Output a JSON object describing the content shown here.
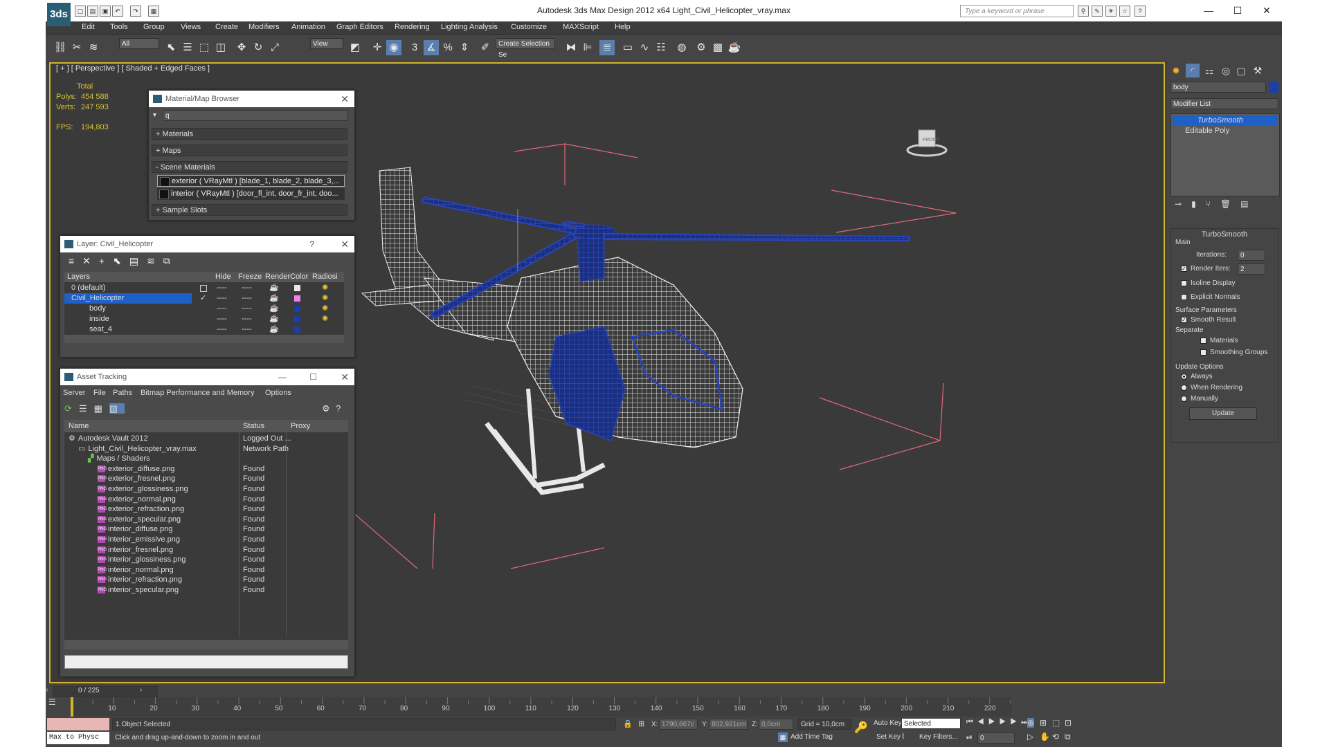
{
  "window": {
    "title": "Autodesk 3ds Max Design 2012 x64      Light_Civil_Helicopter_vray.max",
    "logo": "3ds",
    "search_placeholder": "Type a keyword or phrase"
  },
  "menu": [
    "Edit",
    "Tools",
    "Group",
    "Views",
    "Create",
    "Modifiers",
    "Animation",
    "Graph Editors",
    "Rendering",
    "Lighting Analysis",
    "Customize",
    "MAXScript",
    "Help"
  ],
  "toolbar": {
    "selection_filter": "All",
    "ref_coord": "View",
    "named_selection": "Create Selection Se",
    "snap_label": "3"
  },
  "viewport": {
    "label": "[ + ] [ Perspective ] [ Shaded + Edged Faces ]",
    "stats": {
      "total_label": "Total",
      "polys_label": "Polys:",
      "polys": "454 588",
      "verts_label": "Verts:",
      "verts": "247 593",
      "fps_label": "FPS:",
      "fps": "194,803"
    }
  },
  "material_browser": {
    "title": "Material/Map Browser",
    "search_value": "q",
    "groups": [
      "+ Materials",
      "+ Maps",
      "- Scene Materials",
      "+ Sample Slots"
    ],
    "materials": [
      "exterior ( VRayMtl ) [blade_1, blade_2, blade_3,...",
      "interior ( VRayMtl ) [door_fl_int, door_fr_int, doo..."
    ]
  },
  "layer_manager": {
    "title": "Layer: Civil_Helicopter",
    "help": "?",
    "columns": [
      "Layers",
      "Hide",
      "Freeze",
      "Render",
      "Color",
      "Radiosi"
    ],
    "rows": [
      {
        "name": "0 (default)",
        "color": "#e8e8e8",
        "indent": 0
      },
      {
        "name": "Civil_Helicopter",
        "color": "#f080f0",
        "indent": 0
      },
      {
        "name": "body",
        "color": "#1c3ea8",
        "indent": 1
      },
      {
        "name": "inside",
        "color": "#1c3ea8",
        "indent": 1
      },
      {
        "name": "seat_4",
        "color": "#1c3ea8",
        "indent": 1
      }
    ]
  },
  "asset_tracking": {
    "title": "Asset Tracking",
    "menu": [
      "Server",
      "File",
      "Paths",
      "Bitmap Performance and Memory",
      "Options"
    ],
    "columns": [
      "Name",
      "Status",
      "Proxy"
    ],
    "rows": [
      {
        "name": "Autodesk Vault 2012",
        "status": "Logged Out ...",
        "indent": 0,
        "type": "vault"
      },
      {
        "name": "Light_Civil_Helicopter_vray.max",
        "status": "Network Path",
        "indent": 1,
        "type": "file"
      },
      {
        "name": "Maps / Shaders",
        "status": "",
        "indent": 2,
        "type": "folder"
      },
      {
        "name": "exterior_diffuse.png",
        "status": "Found",
        "indent": 3,
        "type": "png"
      },
      {
        "name": "exterior_fresnel.png",
        "status": "Found",
        "indent": 3,
        "type": "png"
      },
      {
        "name": "exterior_glossiness.png",
        "status": "Found",
        "indent": 3,
        "type": "png"
      },
      {
        "name": "exterior_normal.png",
        "status": "Found",
        "indent": 3,
        "type": "png"
      },
      {
        "name": "exterior_refraction.png",
        "status": "Found",
        "indent": 3,
        "type": "png"
      },
      {
        "name": "exterior_specular.png",
        "status": "Found",
        "indent": 3,
        "type": "png"
      },
      {
        "name": "interior_diffuse.png",
        "status": "Found",
        "indent": 3,
        "type": "png"
      },
      {
        "name": "interior_emissive.png",
        "status": "Found",
        "indent": 3,
        "type": "png"
      },
      {
        "name": "interior_fresnel.png",
        "status": "Found",
        "indent": 3,
        "type": "png"
      },
      {
        "name": "interior_glossiness.png",
        "status": "Found",
        "indent": 3,
        "type": "png"
      },
      {
        "name": "interior_normal.png",
        "status": "Found",
        "indent": 3,
        "type": "png"
      },
      {
        "name": "interior_refraction.png",
        "status": "Found",
        "indent": 3,
        "type": "png"
      },
      {
        "name": "interior_specular.png",
        "status": "Found",
        "indent": 3,
        "type": "png"
      }
    ]
  },
  "command_panel": {
    "object_name": "body",
    "modifier_list": "Modifier List",
    "stack": [
      "TurboSmooth",
      "Editable Poly"
    ],
    "rollout_title": "TurboSmooth",
    "main_label": "Main",
    "iterations_label": "Iterations:",
    "iterations": "0",
    "render_iters_label": "Render Iters:",
    "render_iters": "2",
    "isoline_label": "Isoline Display",
    "explicit_normals_label": "Explicit Normals",
    "surface_params_label": "Surface Parameters",
    "smooth_result_label": "Smooth Result",
    "separate_label": "Separate",
    "materials_label": "Materials",
    "smoothing_groups_label": "Smoothing Groups",
    "update_options_label": "Update Options",
    "always_label": "Always",
    "when_rendering_label": "When Rendering",
    "manually_label": "Manually",
    "update_button": "Update"
  },
  "timeline": {
    "frame_counter": "0 / 225",
    "ticks": [
      "10",
      "20",
      "30",
      "40",
      "50",
      "60",
      "70",
      "80",
      "90",
      "100",
      "110",
      "120",
      "130",
      "140",
      "150",
      "160",
      "170",
      "180",
      "190",
      "200",
      "210",
      "220"
    ]
  },
  "status": {
    "maxscript": "Max to Physc",
    "selection": "1 Object Selected",
    "prompt": "Click and drag up-and-down to zoom in and out",
    "x_label": "X:",
    "x": "1790,667c",
    "y_label": "Y:",
    "y": "802,921cm",
    "z_label": "Z:",
    "z": "0,0cm",
    "grid": "Grid = 10,0cm",
    "auto_key": "Auto Key",
    "selected": "Selected",
    "set_key": "Set Key",
    "key_filters": "Key Filters...",
    "add_time_tag": "Add Time Tag",
    "frame": "0"
  },
  "colors": {
    "viewport_border": "#d4b32e",
    "selection": "#1f5fc8",
    "stats_text": "#d6c23c",
    "wire_blue": "#2340a8"
  }
}
